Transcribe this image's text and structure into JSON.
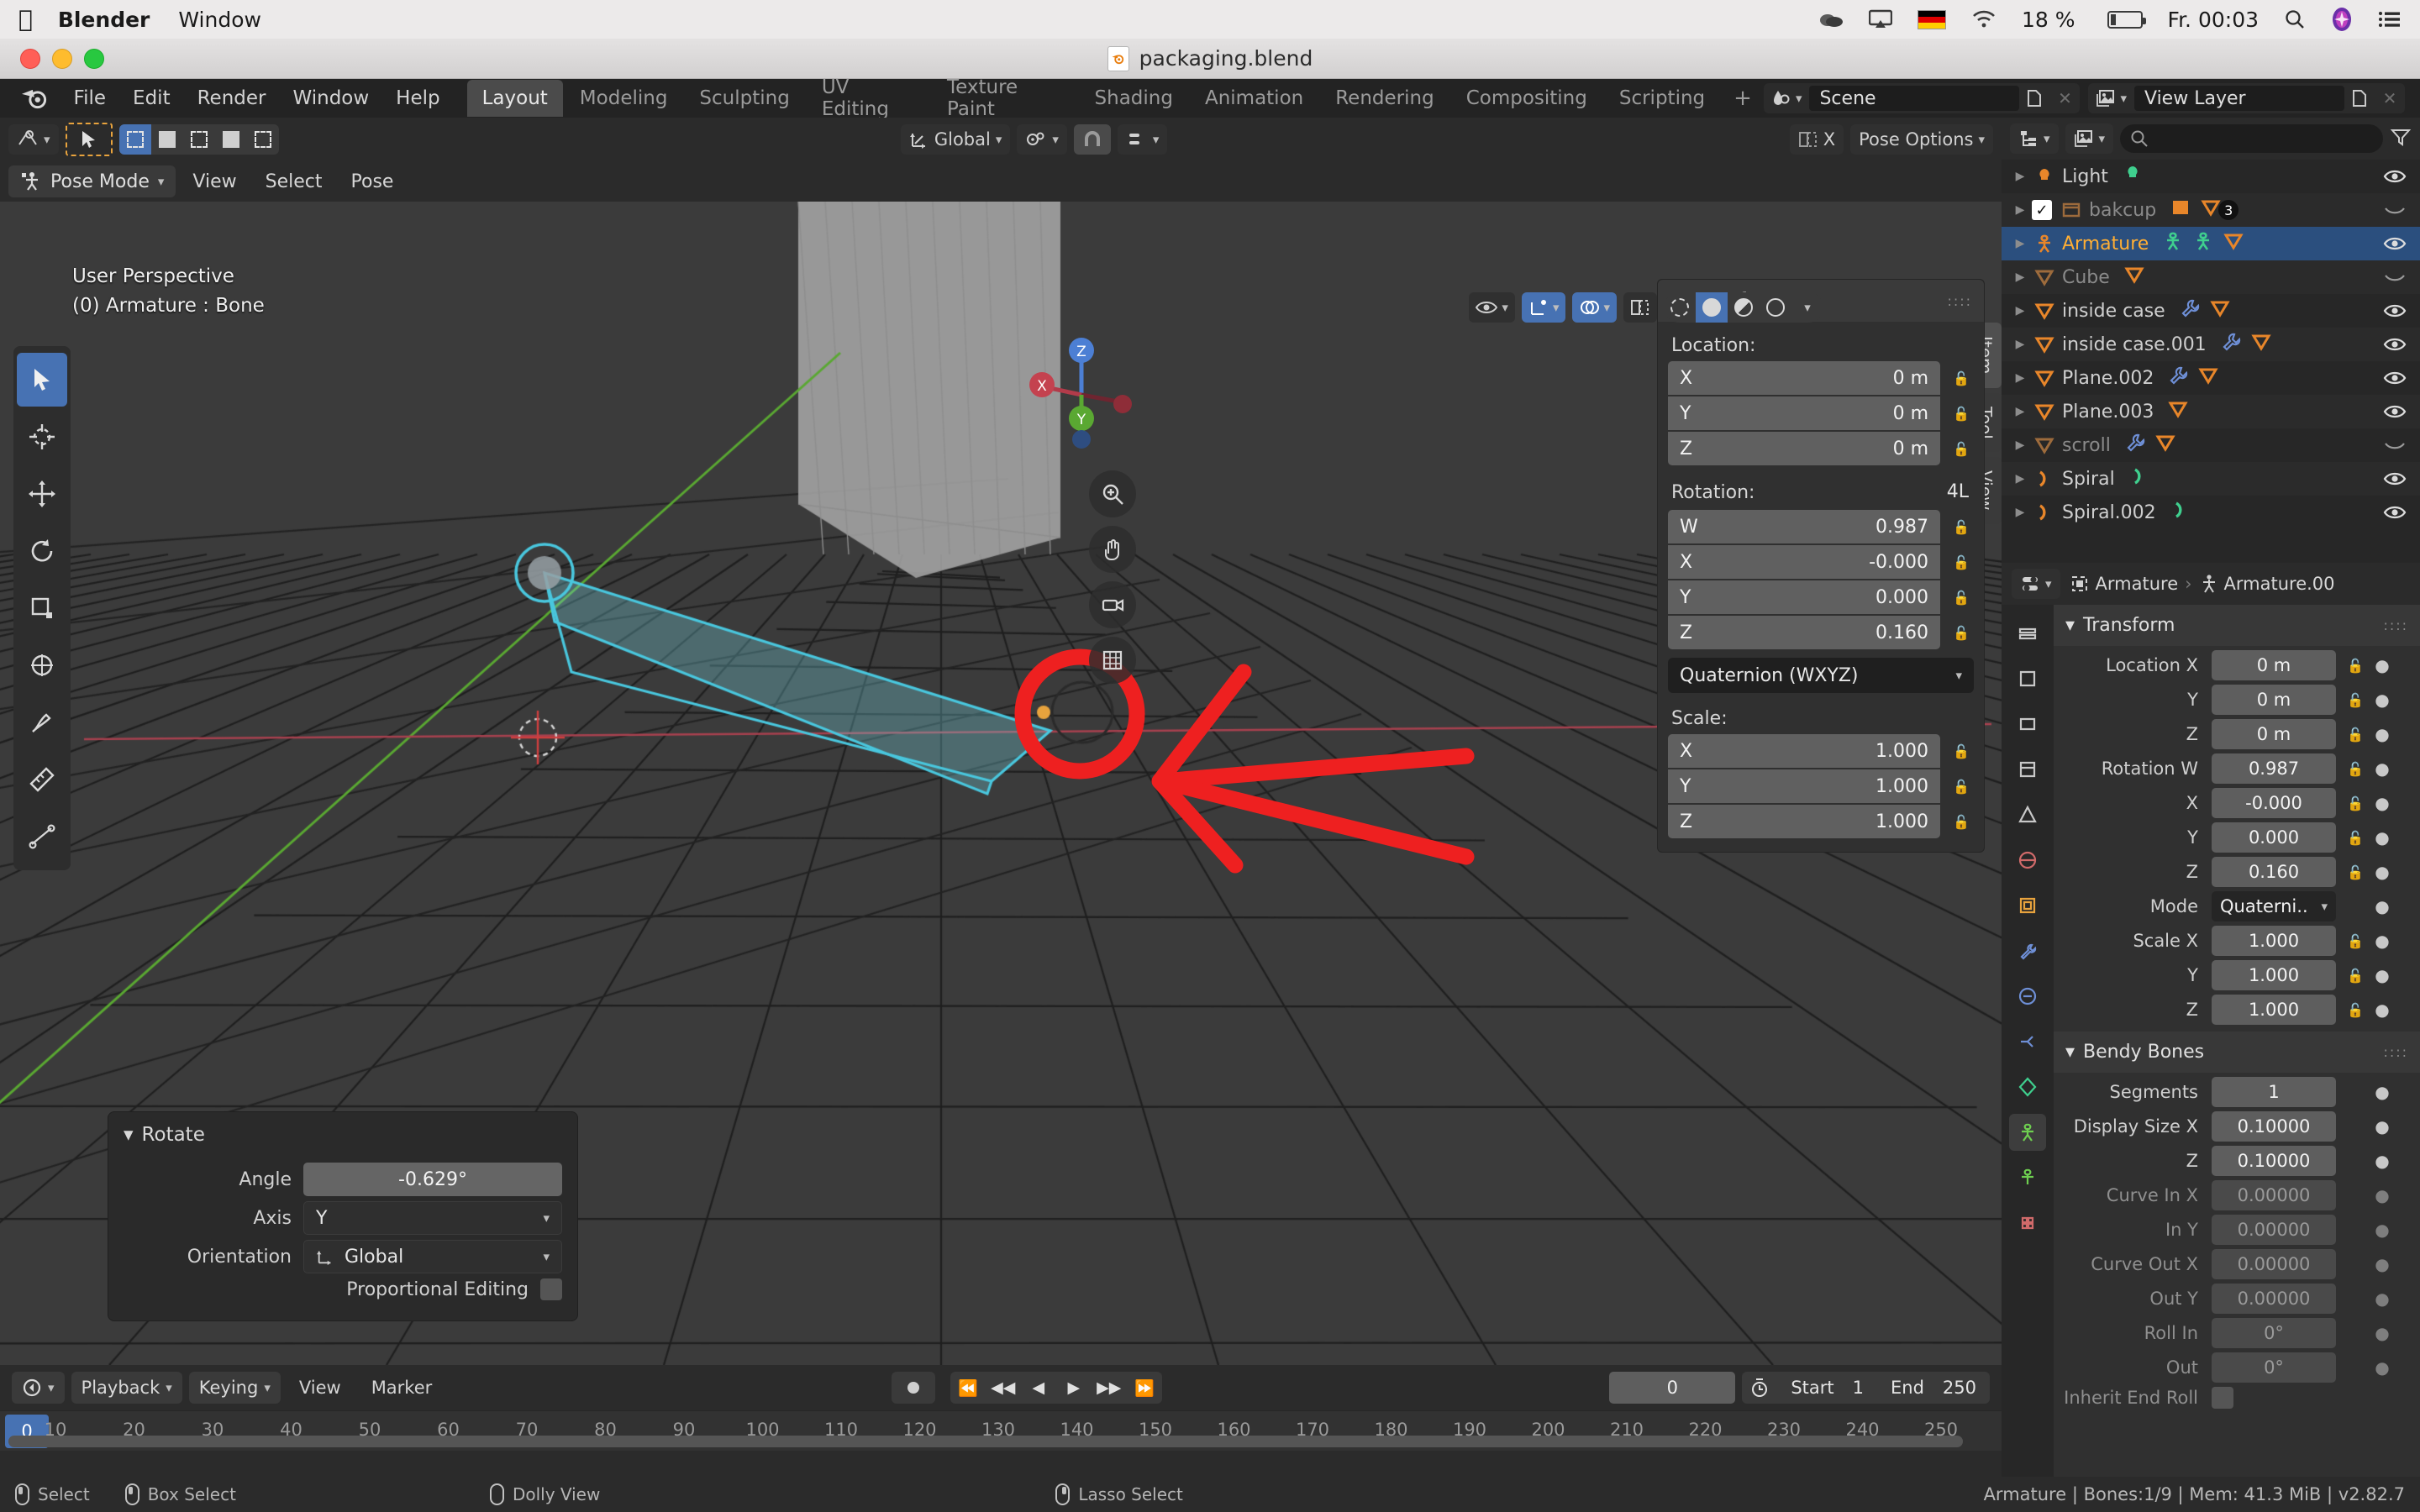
{
  "macbar": {
    "apple_icon": "apple-icon",
    "app_name": "Blender",
    "menu_window": "Window",
    "right": {
      "cloud_icon": "cloud-icon",
      "airplay_icon": "airplay-icon",
      "flag_icon": "german-flag-icon",
      "wifi_icon": "wifi-icon",
      "battery_percent": "18 %",
      "battery_icon": "battery-icon",
      "clock": "Fr. 00:03",
      "search_icon": "search-icon",
      "siri_icon": "siri-icon",
      "controlcenter_icon": "control-center-icon"
    }
  },
  "titlebar": {
    "filename": "packaging.blend",
    "file_icon": "blender-file-icon"
  },
  "topbar": {
    "logo_icon": "blender-logo-icon",
    "menus": [
      "File",
      "Edit",
      "Render",
      "Window",
      "Help"
    ],
    "workspaces": [
      "Layout",
      "Modeling",
      "Sculpting",
      "UV Editing",
      "Texture Paint",
      "Shading",
      "Animation",
      "Rendering",
      "Compositing",
      "Scripting"
    ],
    "active_workspace": "Layout",
    "add_workspace": "+",
    "scene": {
      "icon": "scene-icon",
      "name": "Scene",
      "new_icon": "new-scene-icon",
      "x_icon": "unlink-icon"
    },
    "view_layer": {
      "icon": "view-layer-icon",
      "name": "View Layer",
      "new_icon": "new-layer-icon",
      "x_icon": "unlink-icon"
    }
  },
  "viewport": {
    "header": {
      "editor_type_icon": "editor-type-3dview-icon",
      "cursor_icon": "tweak-cursor-icon",
      "select_modes": [
        "set-select-icon",
        "extend-select-icon",
        "subtract-select-icon",
        "invert-select-icon",
        "intersect-select-icon"
      ],
      "active_select_mode": 0,
      "orientation_icon": "orientation-global-icon",
      "orientation": "Global",
      "pivot_icon": "pivot-point-icon",
      "snap_icon": "snap-magnet-icon",
      "proportional_icon": "proportional-editing-icon",
      "xray_label": "X",
      "pose_options": "Pose Options",
      "overlays_icon": "overlays-icon",
      "gizmo_icon": "gizmo-icon",
      "shading_icons": [
        "wireframe-shading-icon",
        "solid-shading-icon",
        "material-shading-icon",
        "rendered-shading-icon"
      ],
      "active_shading": 1,
      "visibility_icon": "visibility-icon"
    },
    "mode": {
      "icon": "pose-mode-icon",
      "label": "Pose Mode"
    },
    "menus": [
      "View",
      "Select",
      "Pose"
    ],
    "overlay_line1": "User Perspective",
    "overlay_line2": "(0) Armature : Bone",
    "toolbar": [
      "tweak-select-box-tool",
      "cursor-tool",
      "move-tool",
      "rotate-tool",
      "scale-tool",
      "transform-tool",
      "annotate-tool",
      "measure-tool",
      "bone-size-tool"
    ],
    "gizmo": {
      "x": "X",
      "y": "Y",
      "z": "Z"
    },
    "nav_buttons": [
      "zoom-icon",
      "pan-hand-icon",
      "camera-view-icon",
      "toggle-ortho-icon"
    ]
  },
  "npanel": {
    "tabs": [
      "Item",
      "Tool",
      "View"
    ],
    "active_tab": "Item",
    "title": "Transform",
    "sections": {
      "location_label": "Location:",
      "location": [
        {
          "axis": "X",
          "value": "0 m"
        },
        {
          "axis": "Y",
          "value": "0 m"
        },
        {
          "axis": "Z",
          "value": "0 m"
        }
      ],
      "rotation_label": "Rotation:",
      "rotation_mode_badge": "4L",
      "rotation": [
        {
          "axis": "W",
          "value": "0.987"
        },
        {
          "axis": "X",
          "value": "-0.000"
        },
        {
          "axis": "Y",
          "value": "0.000"
        },
        {
          "axis": "Z",
          "value": "0.160"
        }
      ],
      "rotation_mode": "Quaternion (WXYZ)",
      "scale_label": "Scale:",
      "scale": [
        {
          "axis": "X",
          "value": "1.000"
        },
        {
          "axis": "Y",
          "value": "1.000"
        },
        {
          "axis": "Z",
          "value": "1.000"
        }
      ]
    }
  },
  "operator_panel": {
    "title": "Rotate",
    "rows": [
      {
        "label": "Angle",
        "value": "-0.629°",
        "type": "value"
      },
      {
        "label": "Axis",
        "value": "Y",
        "type": "select"
      },
      {
        "label": "Orientation",
        "value": "Global",
        "type": "select-icon",
        "icon": "orientation-global-icon"
      }
    ],
    "checkbox_label": "Proportional Editing",
    "checkbox_checked": false
  },
  "outliner": {
    "header": {
      "editor_icon": "outliner-editor-icon",
      "display_mode_icon": "view-layer-icon",
      "search_icon": "search-icon",
      "search_placeholder": "",
      "filter_icon": "filter-icon"
    },
    "items": [
      {
        "name": "Light",
        "icon": "light-icon",
        "state": "normal",
        "data_icons": [
          "light-data-icon"
        ],
        "visible": true,
        "checkbox": null,
        "badge": null
      },
      {
        "name": "bakcup",
        "icon": "collection-icon",
        "state": "dim",
        "data_icons": [
          "image-icon",
          "mesh-icon"
        ],
        "visible": false,
        "checkbox": true,
        "badge": "3"
      },
      {
        "name": "Armature",
        "icon": "armature-icon",
        "state": "selected",
        "data_icons": [
          "pose-icon",
          "armature-data-icon",
          "mesh-icon"
        ],
        "visible": true,
        "checkbox": null,
        "badge": null
      },
      {
        "name": "Cube",
        "icon": "mesh-icon",
        "state": "dim",
        "data_icons": [
          "mesh-data-icon"
        ],
        "visible": false,
        "checkbox": null,
        "badge": null
      },
      {
        "name": "inside case",
        "icon": "mesh-icon",
        "state": "normal",
        "data_icons": [
          "modifier-icon",
          "mesh-data-icon"
        ],
        "visible": true,
        "checkbox": null,
        "badge": null
      },
      {
        "name": "inside case.001",
        "icon": "mesh-icon",
        "state": "normal",
        "data_icons": [
          "modifier-icon",
          "mesh-data-icon"
        ],
        "visible": true,
        "checkbox": null,
        "badge": null
      },
      {
        "name": "Plane.002",
        "icon": "mesh-icon",
        "state": "normal",
        "data_icons": [
          "modifier-icon",
          "mesh-data-icon"
        ],
        "visible": true,
        "checkbox": null,
        "badge": null
      },
      {
        "name": "Plane.003",
        "icon": "mesh-icon",
        "state": "normal",
        "data_icons": [
          "mesh-data-icon"
        ],
        "visible": true,
        "checkbox": null,
        "badge": null
      },
      {
        "name": "scroll",
        "icon": "mesh-icon",
        "state": "dim",
        "data_icons": [
          "modifier-icon",
          "mesh-data-icon"
        ],
        "visible": false,
        "checkbox": null,
        "badge": null
      },
      {
        "name": "Spiral",
        "icon": "curve-icon",
        "state": "normal",
        "data_icons": [
          "curve-data-icon"
        ],
        "visible": true,
        "checkbox": null,
        "badge": null
      },
      {
        "name": "Spiral.002",
        "icon": "curve-icon",
        "state": "normal",
        "data_icons": [
          "curve-data-icon"
        ],
        "visible": true,
        "checkbox": null,
        "badge": null
      }
    ]
  },
  "properties": {
    "header": {
      "editor_icon": "properties-editor-icon",
      "breadcrumb": [
        {
          "icon": "object-icon",
          "label": "Armature"
        },
        {
          "icon": "bone-icon",
          "label": "Armature.00"
        }
      ]
    },
    "tabs": [
      "tool-tab",
      "render-tab",
      "output-tab",
      "view-layer-tab",
      "scene-tab",
      "world-tab",
      "object-tab",
      "modifiers-tab",
      "physics-tab",
      "constraints-tab",
      "data-tab",
      "bone-tab",
      "bone-constraint-tab",
      "material-tab"
    ],
    "active_tab_index": 11,
    "transform": {
      "title": "Transform",
      "rows": [
        {
          "label": "Location X",
          "value": "0 m",
          "dim": false,
          "lock": true
        },
        {
          "label": "Y",
          "value": "0 m",
          "dim": false,
          "lock": true
        },
        {
          "label": "Z",
          "value": "0 m",
          "dim": false,
          "lock": true
        },
        {
          "label": "Rotation W",
          "value": "0.987",
          "dim": false,
          "lock": true
        },
        {
          "label": "X",
          "value": "-0.000",
          "dim": false,
          "lock": true
        },
        {
          "label": "Y",
          "value": "0.000",
          "dim": false,
          "lock": true
        },
        {
          "label": "Z",
          "value": "0.160",
          "dim": false,
          "lock": true
        },
        {
          "label": "Mode",
          "value": "Quaterni..",
          "dim": false,
          "lock": false,
          "select": true
        },
        {
          "label": "Scale X",
          "value": "1.000",
          "dim": false,
          "lock": true
        },
        {
          "label": "Y",
          "value": "1.000",
          "dim": false,
          "lock": true
        },
        {
          "label": "Z",
          "value": "1.000",
          "dim": false,
          "lock": true
        }
      ]
    },
    "bendy_bones": {
      "title": "Bendy Bones",
      "rows": [
        {
          "label": "Segments",
          "value": "1",
          "dim": false,
          "lock": false
        },
        {
          "label": "Display Size X",
          "value": "0.10000",
          "dim": false,
          "lock": false
        },
        {
          "label": "Z",
          "value": "0.10000",
          "dim": false,
          "lock": false
        },
        {
          "label": "Curve In X",
          "value": "0.00000",
          "dim": true,
          "lock": false
        },
        {
          "label": "In Y",
          "value": "0.00000",
          "dim": true,
          "lock": false
        },
        {
          "label": "Curve Out X",
          "value": "0.00000",
          "dim": true,
          "lock": false
        },
        {
          "label": "Out Y",
          "value": "0.00000",
          "dim": true,
          "lock": false
        },
        {
          "label": "Roll In",
          "value": "0°",
          "dim": true,
          "lock": false
        },
        {
          "label": "Out",
          "value": "0°",
          "dim": true,
          "lock": false
        }
      ],
      "footer_label": "Inherit End Roll"
    }
  },
  "timeline": {
    "editor_icon": "timeline-editor-icon",
    "menus": [
      {
        "label": "Playback",
        "dropdown": true
      },
      {
        "label": "Keying",
        "dropdown": true
      },
      {
        "label": "View",
        "dropdown": false
      },
      {
        "label": "Marker",
        "dropdown": false
      }
    ],
    "record_icon": "auto-keying-icon",
    "playback_buttons": [
      "jump-start-icon",
      "prev-keyframe-icon",
      "play-reverse-icon",
      "play-icon",
      "next-keyframe-icon",
      "jump-end-icon"
    ],
    "current_frame": "0",
    "clock_icon": "use-preview-range-icon",
    "start_label": "Start",
    "start_value": "1",
    "end_label": "End",
    "end_value": "250",
    "ruler_ticks": [
      "10",
      "20",
      "30",
      "40",
      "50",
      "60",
      "70",
      "80",
      "90",
      "100",
      "110",
      "120",
      "130",
      "140",
      "150",
      "160",
      "170",
      "180",
      "190",
      "200",
      "210",
      "220",
      "230",
      "240",
      "250"
    ],
    "playhead_label": "0"
  },
  "statusbar": {
    "items": [
      {
        "icon": "mouse-left-icon",
        "label": "Select"
      },
      {
        "icon": "mouse-left-drag-icon",
        "label": "Box Select"
      },
      {
        "icon": "mouse-middle-icon",
        "label": "Dolly View"
      },
      {
        "icon": "mouse-right-icon",
        "label": "Lasso Select"
      }
    ],
    "info": "Armature | Bones:1/9  | Mem: 41.3 MiB | v2.82.7"
  },
  "colors": {
    "accent_blue": "#4772b3",
    "selected_orange": "#ffae34",
    "bone_cyan": "#3ec8e0",
    "annotation_red": "#ee2020",
    "viewport_bg": "#3b3b3b",
    "panel_bg": "#303030",
    "header_bg": "#2b2b2b"
  },
  "annotations": {
    "circle": "red-circle-highlight",
    "arrow": "red-arrow-pointing-left"
  }
}
